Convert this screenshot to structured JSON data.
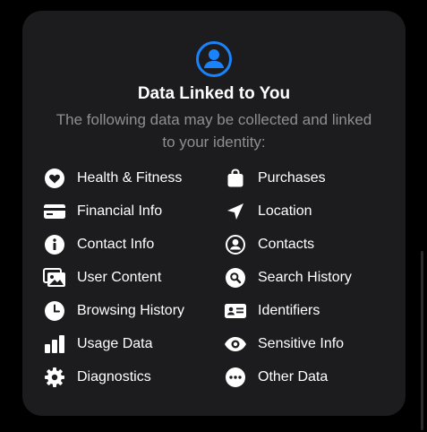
{
  "header": {
    "icon": "person-circle-icon",
    "title": "Data Linked to You",
    "subtitle": "The following data may be collected and linked to your identity:"
  },
  "items": [
    {
      "label": "Health & Fitness",
      "icon": "heart-icon"
    },
    {
      "label": "Purchases",
      "icon": "shopping-bag-icon"
    },
    {
      "label": "Financial Info",
      "icon": "credit-card-icon"
    },
    {
      "label": "Location",
      "icon": "location-arrow-icon"
    },
    {
      "label": "Contact Info",
      "icon": "info-icon"
    },
    {
      "label": "Contacts",
      "icon": "person-circle-icon"
    },
    {
      "label": "User Content",
      "icon": "photos-icon"
    },
    {
      "label": "Search History",
      "icon": "magnifier-icon"
    },
    {
      "label": "Browsing History",
      "icon": "clock-icon"
    },
    {
      "label": "Identifiers",
      "icon": "id-card-icon"
    },
    {
      "label": "Usage Data",
      "icon": "bar-chart-icon"
    },
    {
      "label": "Sensitive Info",
      "icon": "eye-icon"
    },
    {
      "label": "Diagnostics",
      "icon": "gear-icon"
    },
    {
      "label": "Other Data",
      "icon": "ellipsis-icon"
    }
  ],
  "colors": {
    "accent": "#1a82fb",
    "background": "#1c1c1e",
    "text": "#ffffff",
    "secondary": "#8e8e93"
  }
}
